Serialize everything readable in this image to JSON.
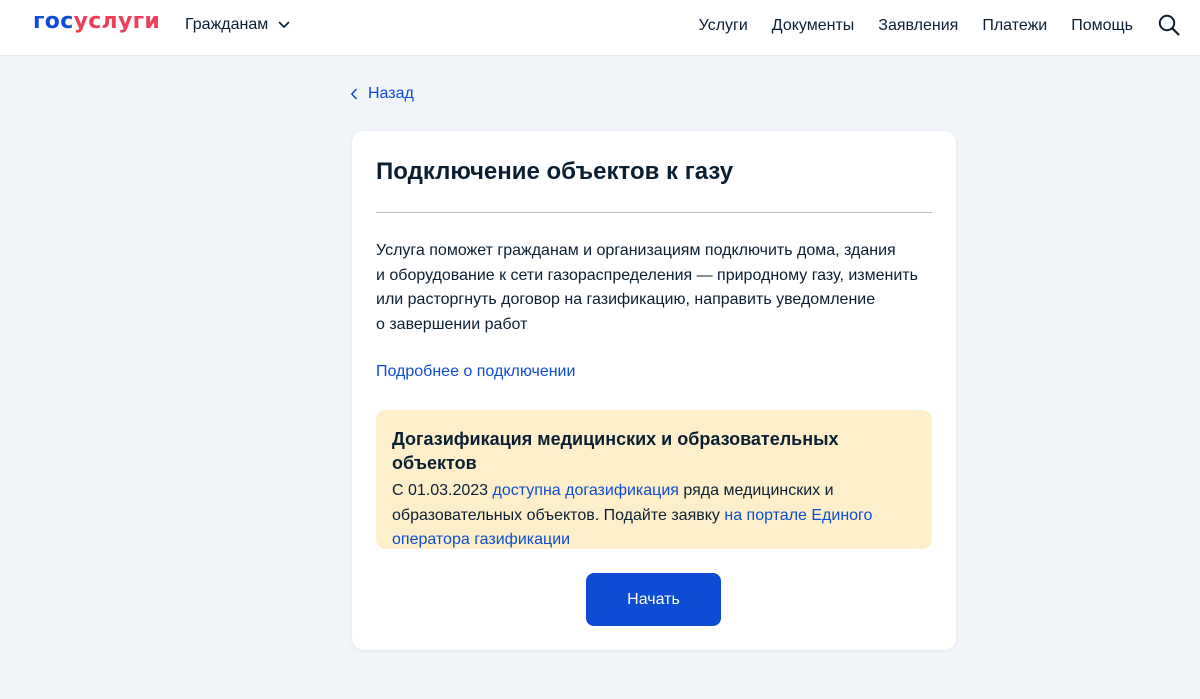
{
  "header": {
    "logo_gos": "гос",
    "logo_uslugi": "услуги",
    "role_select": "Гражданам",
    "nav": [
      "Услуги",
      "Документы",
      "Заявления",
      "Платежи",
      "Помощь"
    ]
  },
  "back": {
    "label": "Назад"
  },
  "card": {
    "title": "Подключение объектов к газу",
    "description": [
      "Услуга поможет гражданам и организациям подключить дома, здания",
      "и оборудование к сети газораспределения — природному газу, изменить",
      "или расторгнуть договор на газификацию, направить уведомление",
      "о завершении работ"
    ],
    "more_link": "Подробнее о подключении",
    "notice": {
      "title": "Догазификация медицинских и образовательных объектов",
      "text_1": "С 01.03.2023 ",
      "link_1": "доступна догазификация",
      "text_2": " ряда медицинских и",
      "text_3": "образовательных объектов. Подайте заявку ",
      "link_2a": "на портале Единого",
      "link_2b": "оператора газификации"
    },
    "start_button": "Начать"
  },
  "colors": {
    "brand_blue": "#0d4cd3",
    "brand_red": "#ee3f58",
    "notice_bg": "#fdefc9",
    "page_bg": "#f1f4f9"
  },
  "icons": {
    "role_chevron": "chevron-down-icon",
    "search": "search-icon",
    "back": "chevron-left-icon"
  }
}
